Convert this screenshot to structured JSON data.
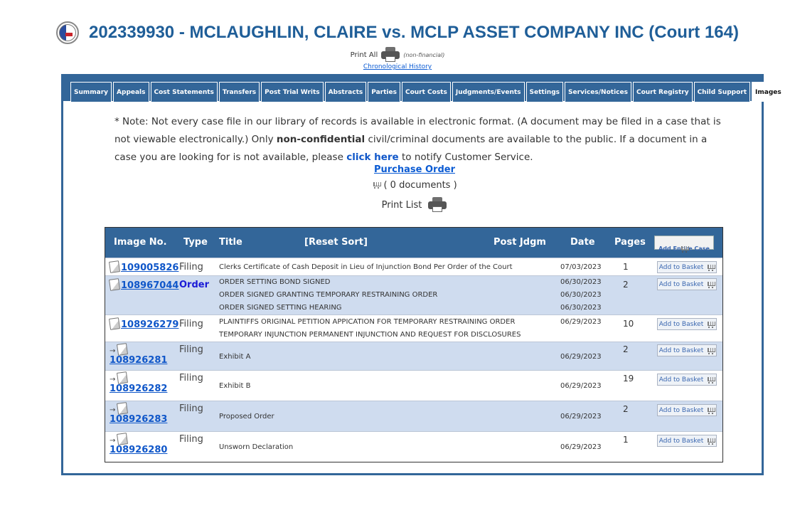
{
  "header": {
    "title": "202339930 - MCLAUGHLIN, CLAIRE vs. MCLP ASSET COMPANY INC (Court 164)",
    "print_all_label": "Print All",
    "non_financial_label": "(non-financial)",
    "chronological_link": "Chronological History"
  },
  "tabs": [
    {
      "label": "Summary"
    },
    {
      "label": "Appeals"
    },
    {
      "label": "Cost Statements"
    },
    {
      "label": "Transfers"
    },
    {
      "label": "Post Trial Writs"
    },
    {
      "label": "Abstracts"
    },
    {
      "label": "Parties"
    },
    {
      "label": "Court Costs"
    },
    {
      "label": "Judgments/Events"
    },
    {
      "label": "Settings"
    },
    {
      "label": "Services/Notices"
    },
    {
      "label": "Court Registry"
    },
    {
      "label": "Child Support"
    },
    {
      "label": "Images",
      "active": true
    }
  ],
  "note": {
    "part1": "* Note: Not every case file in our library of records is available in electronic format. (A document may be filed in a case that is not viewable electronically.) Only ",
    "bold": "non-confidential",
    "part2": " civil/criminal documents are available to the public. If a document in a case you are looking for is not available, please ",
    "link": "click here",
    "part3": " to notify Customer Service."
  },
  "purchase_order_link": "Purchase Order",
  "document_count": "( 0 documents )",
  "print_list_label": "Print List",
  "table": {
    "headers": {
      "image_no": "Image No.",
      "type": "Type",
      "title": "Title",
      "reset_sort": "[Reset Sort]",
      "post_jdgm": "Post Jdgm",
      "date": "Date",
      "pages": "Pages",
      "add_entire_case": "Add Entire Case"
    },
    "add_to_basket_label": "Add to Basket",
    "rows": [
      {
        "image_no": "109005826",
        "type": "Filing",
        "titles": [
          "Clerks Certificate of Cash Deposit in Lieu of Injunction Bond Per Order of the Court"
        ],
        "dates": [
          "07/03/2023"
        ],
        "pages": "1"
      },
      {
        "image_no": "108967044",
        "type": "Order",
        "titles": [
          "ORDER SETTING BOND SIGNED",
          "ORDER SIGNED GRANTING TEMPORARY RESTRAINING ORDER",
          "ORDER SIGNED SETTING HEARING"
        ],
        "dates": [
          "06/30/2023",
          "06/30/2023",
          "06/30/2023"
        ],
        "pages": "2"
      },
      {
        "image_no": "108926279",
        "type": "Filing",
        "titles": [
          "PLAINTIFFS ORIGINAL PETITION APPICATION FOR TEMPORARY RESTRAINING ORDER",
          "TEMPORARY INJUNCTION PERMANENT INJUNCTION AND REQUEST FOR DISCLOSURES"
        ],
        "dates": [
          "06/29/2023"
        ],
        "pages": "10"
      },
      {
        "image_no": "108926281",
        "type": "Filing",
        "titles": [
          "Exhibit A"
        ],
        "dates": [
          "06/29/2023"
        ],
        "pages": "2"
      },
      {
        "image_no": "108926282",
        "type": "Filing",
        "titles": [
          "Exhibit B"
        ],
        "dates": [
          "06/29/2023"
        ],
        "pages": "19"
      },
      {
        "image_no": "108926283",
        "type": "Filing",
        "titles": [
          "Proposed Order"
        ],
        "dates": [
          "06/29/2023"
        ],
        "pages": "2"
      },
      {
        "image_no": "108926280",
        "type": "Filing",
        "titles": [
          "Unsworn Declaration"
        ],
        "dates": [
          "06/29/2023"
        ],
        "pages": "1"
      }
    ]
  }
}
